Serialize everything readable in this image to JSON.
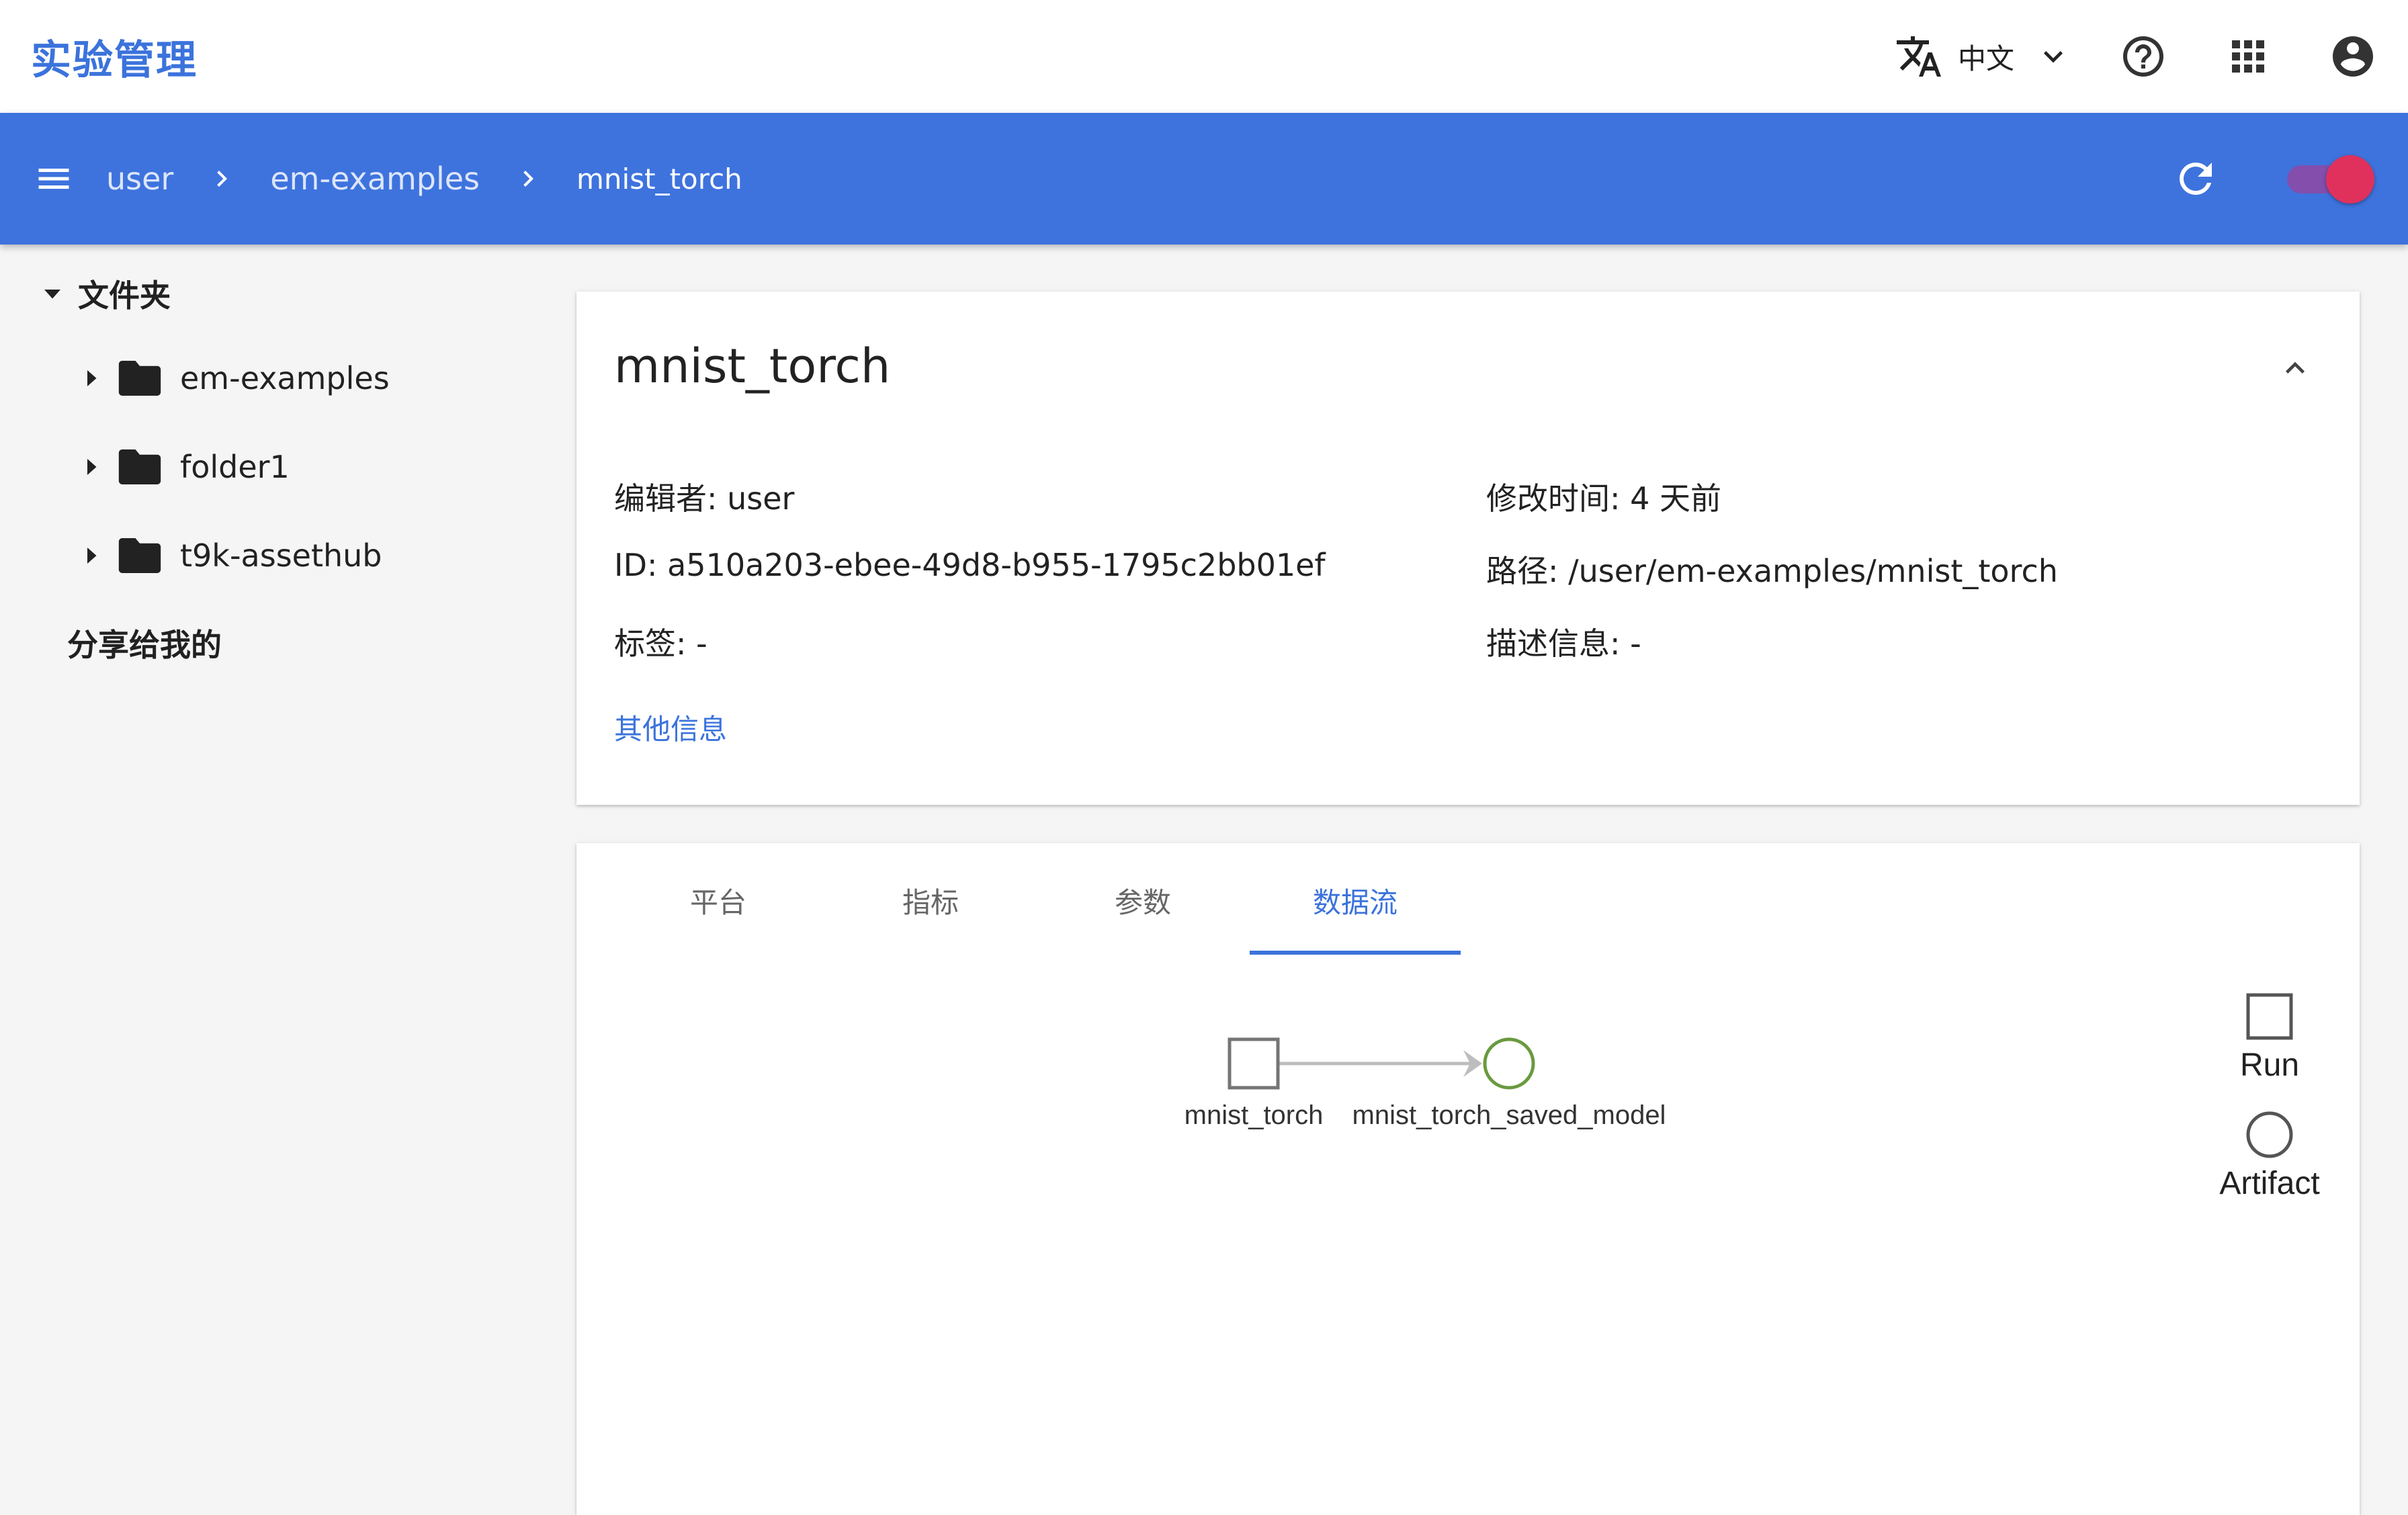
{
  "app": {
    "title": "实验管理"
  },
  "topbar": {
    "language_icon": "translate-icon",
    "language": "中文",
    "icons": [
      "help-circle-icon",
      "apps-grid-icon",
      "account-circle-icon"
    ]
  },
  "navbar": {
    "menu_icon": "menu-icon",
    "breadcrumbs": [
      "user",
      "em-examples",
      "mnist_torch"
    ],
    "refresh_icon": "refresh-icon"
  },
  "sidebar": {
    "root_label": "文件夹",
    "folders": [
      "em-examples",
      "folder1",
      "t9k-assethub"
    ],
    "shared_label": "分享给我的"
  },
  "info": {
    "title": "mnist_torch",
    "editor": "编辑者: user",
    "modified": "修改时间: 4 天前",
    "id": "ID: a510a203-ebee-49d8-b955-1795c2bb01ef",
    "path": "路径: /user/em-examples/mnist_torch",
    "tags": "标签: -",
    "description": "描述信息: -",
    "more_link": "其他信息"
  },
  "tabs": {
    "items": [
      "平台",
      "指标",
      "参数",
      "数据流"
    ],
    "active_index": 3
  },
  "dataflow": {
    "nodes": [
      {
        "label": "mnist_torch",
        "kind": "Run"
      },
      {
        "label": "mnist_torch_saved_model",
        "kind": "Artifact"
      }
    ],
    "legend": [
      "Run",
      "Artifact"
    ],
    "colors": {
      "run": "#757575",
      "artifact": "#6a9a3e",
      "edge": "#bdbdbd"
    }
  },
  "colors": {
    "primary": "#3e73de",
    "accent": "#e0315d",
    "link": "#3b73dc"
  }
}
